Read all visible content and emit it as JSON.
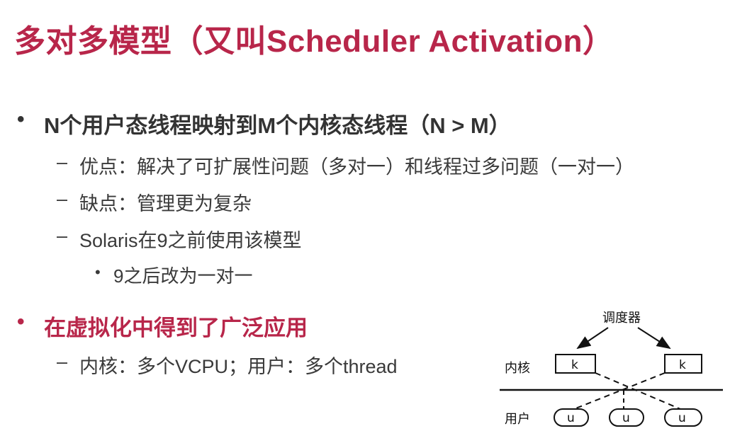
{
  "title": "多对多模型（又叫Scheduler Activation）",
  "bullets": [
    {
      "text": "N个用户态线程映射到M个内核态线程（N > M）",
      "subs": [
        {
          "text": "优点：解决了可扩展性问题（多对一）和线程过多问题（一对一）"
        },
        {
          "text": "缺点：管理更为复杂"
        },
        {
          "text": "Solaris在9之前使用该模型",
          "subsub": "9之后改为一对一"
        }
      ]
    },
    {
      "text": "在虚拟化中得到了广泛应用",
      "subs": [
        {
          "text": "内核：多个VCPU；用户：多个thread"
        }
      ]
    }
  ],
  "markers": {
    "bullet": "•",
    "dash": "–",
    "small_bullet": "•"
  },
  "diagram": {
    "scheduler_label": "调度器",
    "kernel_label": "内核",
    "user_label": "用户",
    "kernel_box_label": "k",
    "user_box_label": "u"
  },
  "colors": {
    "accent": "#b8264a",
    "text": "#333333"
  }
}
